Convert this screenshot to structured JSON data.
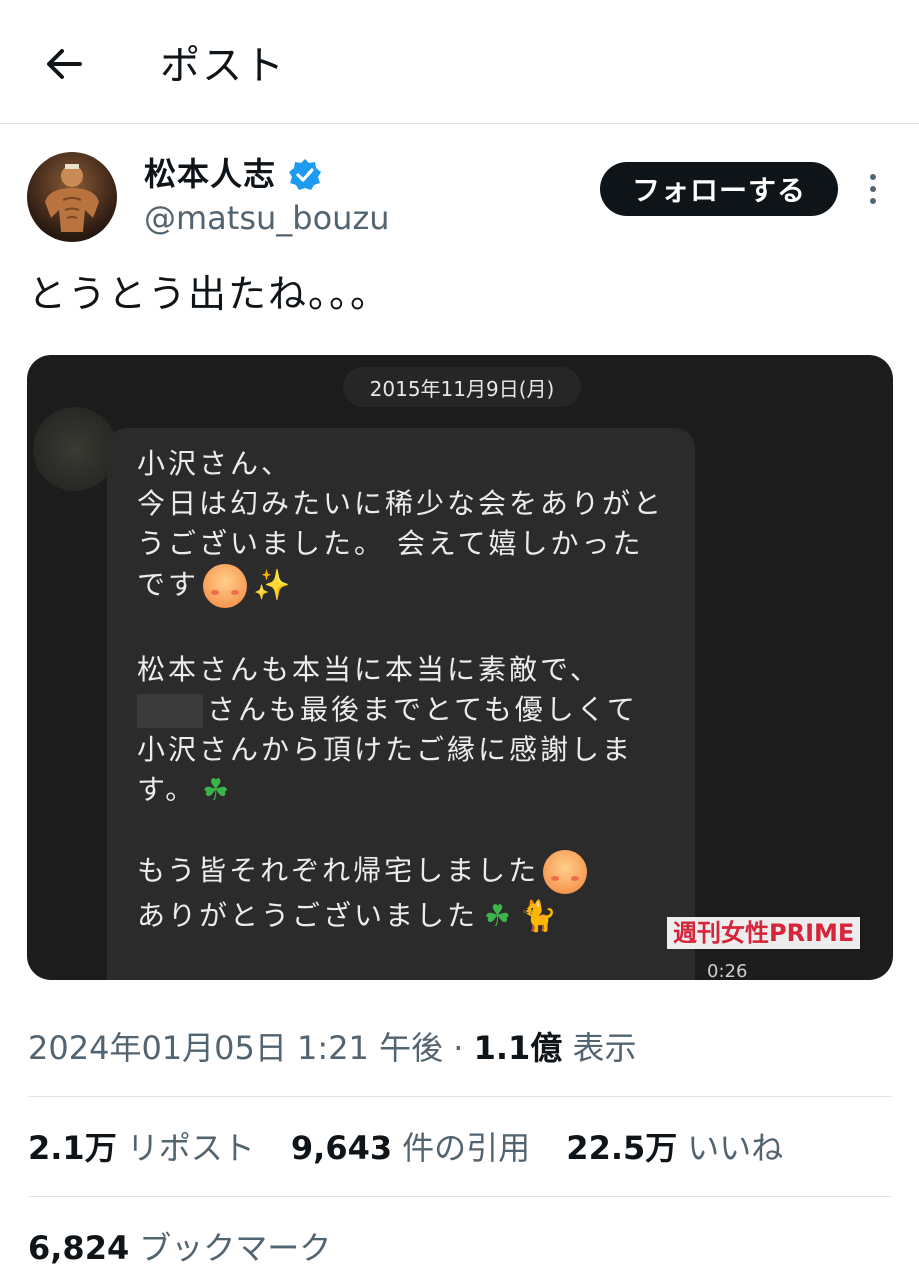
{
  "header": {
    "title": "ポスト",
    "back_icon": "arrow-left-icon"
  },
  "author": {
    "display_name": "松本人志",
    "handle": "@matsu_bouzu",
    "verified_color": "#1d9bf0",
    "follow_label": "フォローする"
  },
  "post": {
    "text": "とうとう出たね。。。",
    "media": {
      "date_label": "2015年11月9日(月)",
      "message_lines": [
        "小沢さん、",
        "今日は幻みたいに稀少な会をありがと",
        "うございました。 会えて嬉しかった",
        "です",
        "",
        "松本さんも本当に本当に素敵で、",
        "さんも最後までとても優しくて",
        "小沢さんから頂けたご縁に感謝しま",
        "す。",
        "",
        "もう皆それぞれ帰宅しました",
        "ありがとうございました"
      ],
      "watermark": "週刊女性PRIME",
      "timecode": "0:26",
      "watermark_color": "#d6253a"
    }
  },
  "meta": {
    "date": "2024年01月05日 1:21 午後",
    "separator": "·",
    "views_count": "1.1億",
    "views_label": "表示"
  },
  "stats": {
    "reposts_count": "2.1万",
    "reposts_label": "リポスト",
    "quotes_count": "9,643",
    "quotes_label": "件の引用",
    "likes_count": "22.5万",
    "likes_label": "いいね",
    "bookmarks_count": "6,824",
    "bookmarks_label": "ブックマーク"
  }
}
